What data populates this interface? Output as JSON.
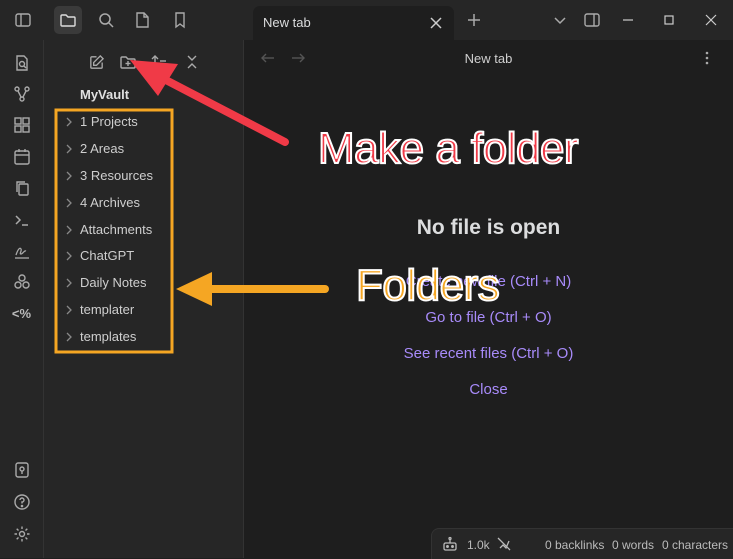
{
  "titlebar": {
    "tab_title": "New tab"
  },
  "main": {
    "header_title": "New tab",
    "empty_title": "No file is open",
    "actions": [
      "Create new file (Ctrl + N)",
      "Go to file (Ctrl + O)",
      "See recent files (Ctrl + O)",
      "Close"
    ]
  },
  "sidebar": {
    "vault_name": "MyVault",
    "folders": [
      "1 Projects",
      "2 Areas",
      "3 Resources",
      "4 Archives",
      "Attachments",
      "ChatGPT",
      "Daily Notes",
      "templater",
      "templates"
    ]
  },
  "ribbon": {
    "template_icon_text": "<%"
  },
  "statusbar": {
    "count": "1.0k",
    "backlinks": "0 backlinks",
    "words": "0 words",
    "characters": "0 characters"
  },
  "annotations": {
    "make_folder": "Make a folder",
    "folders": "Folders"
  },
  "colors": {
    "accent_link": "#a88bfa",
    "annotation_red": "#f03a47",
    "annotation_orange": "#f5a623"
  }
}
